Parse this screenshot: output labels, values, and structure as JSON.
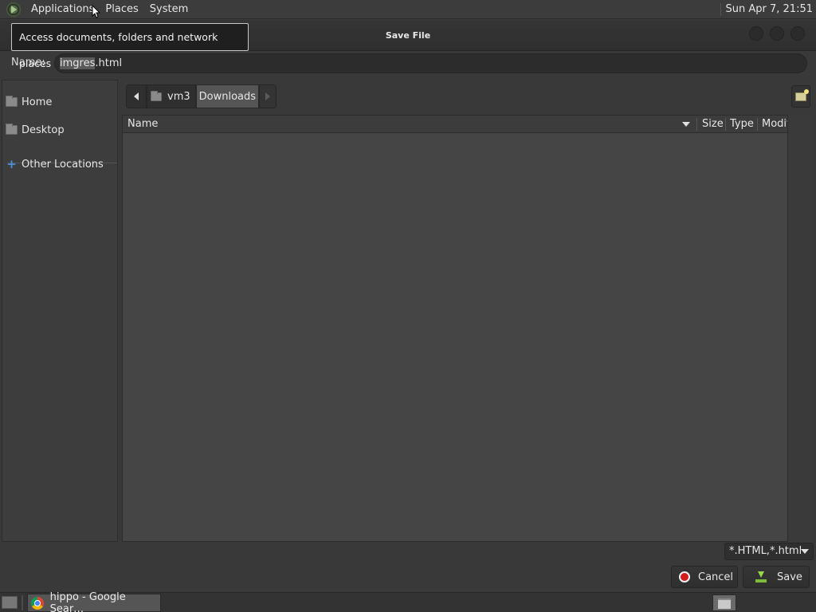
{
  "top_panel": {
    "menus": [
      "Applications",
      "Places",
      "System"
    ],
    "clock": "Sun Apr  7, 21:51"
  },
  "tooltip": "Access documents, folders and network places",
  "dialog": {
    "title": "Save File",
    "name_label": "Name:",
    "name_value_selected": "imgres",
    "name_value_ext": ".html",
    "sidebar": [
      "Home",
      "Desktop",
      "Other Locations"
    ],
    "path": [
      "vm3",
      "Downloads"
    ],
    "columns": [
      "Name",
      "Size",
      "Type",
      "Modif"
    ],
    "filter": "*.HTML,*.html",
    "cancel_label": "Cancel",
    "save_label": "Save"
  },
  "taskbar": {
    "task_label": "hippo - Google Sear…"
  },
  "icons": {
    "menu_logo": "app-menu-icon",
    "home": "folder-home-icon",
    "desktop": "folder-desktop-icon",
    "other": "plus-icon",
    "cancel": "stop-icon",
    "save": "download-icon",
    "new_folder": "new-folder-icon",
    "browser": "chrome-icon"
  },
  "colors": {
    "accent_blue": "#4a90d9",
    "cancel_red": "#d21c1c",
    "save_green": "#7dbb3a"
  }
}
